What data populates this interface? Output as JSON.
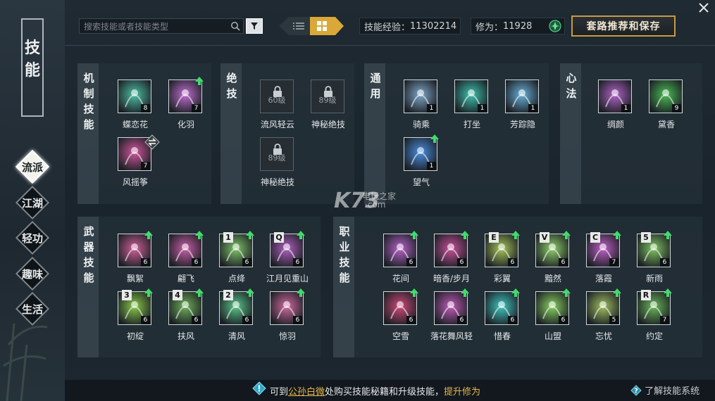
{
  "rail": {
    "title": [
      "技",
      "能"
    ],
    "tabs": [
      {
        "label": "流派",
        "active": true
      },
      {
        "label": "江湖",
        "active": false
      },
      {
        "label": "轻功",
        "active": false
      },
      {
        "label": "趣味",
        "active": false
      },
      {
        "label": "生活",
        "active": false
      }
    ]
  },
  "toolbar": {
    "search_placeholder": "搜索技能或者技能类型",
    "skill_exp_label": "技能经验：",
    "skill_exp_value": "11302214",
    "cultivation_label": "修为：",
    "cultivation_value": "11928",
    "save_label": "套路推荐和保存"
  },
  "sections": {
    "mechanism": {
      "title": [
        "机",
        "制",
        "技",
        "能"
      ],
      "skills": [
        {
          "name": "蝶恋花",
          "level": "8",
          "up": false,
          "swap": false,
          "hue": "#4fbfa5"
        },
        {
          "name": "化羽",
          "level": "7",
          "up": true,
          "swap": false,
          "hue": "#c06fd0"
        },
        {
          "name": "风摇筝",
          "level": "7",
          "up": false,
          "swap": true,
          "hue": "#d0569c"
        }
      ]
    },
    "ultimate": {
      "title": [
        "绝",
        "技"
      ],
      "skills": [
        {
          "name": "流风轻云",
          "lock": "60级"
        },
        {
          "name": "神秘绝技",
          "lock": "89级"
        },
        {
          "name": "神秘绝技",
          "lock": "89级"
        }
      ]
    },
    "common": {
      "title": [
        "通",
        "用"
      ],
      "skills": [
        {
          "name": "骑乘",
          "level": "1",
          "up": false,
          "hue": "#7fa7c9"
        },
        {
          "name": "打坐",
          "level": "1",
          "up": false,
          "hue": "#3fc2b0"
        },
        {
          "name": "芳踪隐",
          "level": "1",
          "up": false,
          "hue": "#6ab0d8"
        },
        {
          "name": "望气",
          "level": "1",
          "up": true,
          "hue": "#4a8fe0"
        }
      ]
    },
    "heart": {
      "title": [
        "心",
        "法"
      ],
      "skills": [
        {
          "name": "绸颜",
          "level": "1",
          "up": false,
          "hue": "#b064c8"
        },
        {
          "name": "黛香",
          "level": "9",
          "up": false,
          "hue": "#4cbb55"
        }
      ]
    },
    "weapon": {
      "title": [
        "武",
        "器",
        "技",
        "能"
      ],
      "skills": [
        {
          "name": "飘絮",
          "level": "6",
          "up": true,
          "key": "",
          "hue": "#d0609a"
        },
        {
          "name": "翩飞",
          "level": "6",
          "up": true,
          "key": "",
          "hue": "#c85fa8"
        },
        {
          "name": "点绛",
          "level": "6",
          "up": true,
          "key": "1",
          "hue": "#7fc46a"
        },
        {
          "name": "江月见重山",
          "level": "6",
          "up": true,
          "key": "Q",
          "hue": "#b060c0"
        },
        {
          "name": "初绽",
          "level": "6",
          "up": true,
          "key": "3",
          "hue": "#88c94a"
        },
        {
          "name": "扶风",
          "level": "6",
          "up": true,
          "key": "4",
          "hue": "#6fb05a"
        },
        {
          "name": "清风",
          "level": "6",
          "up": true,
          "key": "2",
          "hue": "#5ac48a"
        },
        {
          "name": "惊羽",
          "level": "6",
          "up": true,
          "key": "",
          "hue": "#d06aa0"
        }
      ]
    },
    "class": {
      "title": [
        "职",
        "业",
        "技",
        "能"
      ],
      "skills": [
        {
          "name": "花间",
          "level": "6",
          "up": true,
          "key": "",
          "hue": "#b564c8"
        },
        {
          "name": "暗香/步月",
          "level": "6",
          "up": true,
          "key": "",
          "hue": "#c8509c"
        },
        {
          "name": "彩翼",
          "level": "6",
          "up": true,
          "key": "E",
          "hue": "#a8c45a"
        },
        {
          "name": "黯然",
          "level": "6",
          "up": true,
          "key": "V",
          "hue": "#8fd06a"
        },
        {
          "name": "落霞",
          "level": "7",
          "up": true,
          "key": "C",
          "hue": "#c060c8"
        },
        {
          "name": "新雨",
          "level": "6",
          "up": true,
          "key": "5",
          "hue": "#7fc460"
        },
        {
          "name": "空雪",
          "level": "6",
          "up": true,
          "key": "",
          "hue": "#d04a7a"
        },
        {
          "name": "落花舞风轻",
          "level": "6",
          "up": true,
          "key": "",
          "hue": "#c05cb8"
        },
        {
          "name": "惜春",
          "level": "6",
          "up": true,
          "key": "",
          "hue": "#3fc6c0"
        },
        {
          "name": "山盟",
          "level": "6",
          "up": true,
          "key": "",
          "hue": "#88d060"
        },
        {
          "name": "忘忧",
          "level": "5",
          "up": true,
          "key": "",
          "hue": "#9fc060"
        },
        {
          "name": "约定",
          "level": "7",
          "up": true,
          "key": "R",
          "hue": "#6ab85a"
        }
      ]
    }
  },
  "footer": {
    "prefix": "可到",
    "npc": "公孙白微",
    "middle": "处购买技能秘籍和升级技能，",
    "link": "提升修为",
    "help": "了解技能系统"
  },
  "watermark": {
    "logo": "K73",
    "line1": "电玩之家",
    "line2": ".com"
  },
  "colors": {
    "accent": "#d9a836",
    "upgrade": "#3fdc6a",
    "gold_text": "#e8b64a"
  }
}
